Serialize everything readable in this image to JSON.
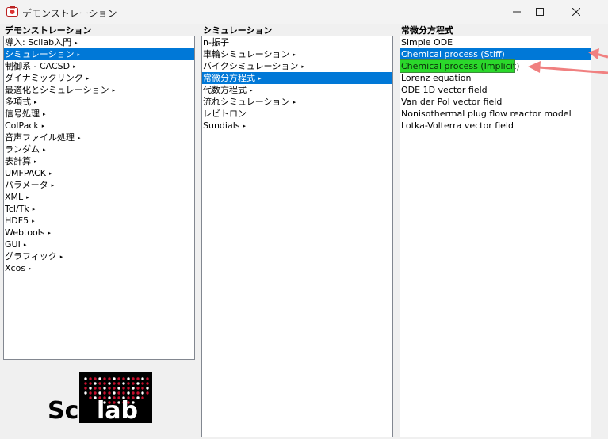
{
  "window": {
    "title": "デモンストレーション",
    "icon": "scilab-app-icon"
  },
  "columns": [
    {
      "header": "デモンストレーション",
      "items": [
        {
          "label": "導入: Scilab入門",
          "has_submenu": true
        },
        {
          "label": "シミュレーション",
          "has_submenu": true,
          "selected": true
        },
        {
          "label": "制御系 - CACSD",
          "has_submenu": true
        },
        {
          "label": "ダイナミックリンク",
          "has_submenu": true
        },
        {
          "label": "最適化とシミュレーション",
          "has_submenu": true
        },
        {
          "label": "多項式",
          "has_submenu": true
        },
        {
          "label": "信号処理",
          "has_submenu": true
        },
        {
          "label": "ColPack",
          "has_submenu": true
        },
        {
          "label": "音声ファイル処理",
          "has_submenu": true
        },
        {
          "label": "ランダム",
          "has_submenu": true
        },
        {
          "label": "表計算",
          "has_submenu": true
        },
        {
          "label": "UMFPACK",
          "has_submenu": true
        },
        {
          "label": "パラメータ",
          "has_submenu": true
        },
        {
          "label": "XML",
          "has_submenu": true
        },
        {
          "label": "Tcl/Tk",
          "has_submenu": true
        },
        {
          "label": "HDF5",
          "has_submenu": true
        },
        {
          "label": "Webtools",
          "has_submenu": true
        },
        {
          "label": "GUI",
          "has_submenu": true
        },
        {
          "label": "グラフィック",
          "has_submenu": true
        },
        {
          "label": "Xcos",
          "has_submenu": true
        }
      ]
    },
    {
      "header": "シミュレーション",
      "items": [
        {
          "label": "n-振子",
          "has_submenu": false
        },
        {
          "label": "車輪シミュレーション",
          "has_submenu": true
        },
        {
          "label": "バイクシミュレーション",
          "has_submenu": true
        },
        {
          "label": "常微分方程式",
          "has_submenu": true,
          "selected": true
        },
        {
          "label": "代数方程式",
          "has_submenu": true
        },
        {
          "label": "流れシミュレーション",
          "has_submenu": true
        },
        {
          "label": "レビトロン",
          "has_submenu": false
        },
        {
          "label": "Sundials",
          "has_submenu": true
        }
      ]
    },
    {
      "header": "常微分方程式",
      "items": [
        {
          "label": "Simple ODE",
          "has_submenu": false
        },
        {
          "label": "Chemical process (Stiff)",
          "has_submenu": false,
          "selected": true
        },
        {
          "label": "Chemical process (Implicit)",
          "has_submenu": false,
          "highlight": true
        },
        {
          "label": "Lorenz equation",
          "has_submenu": false
        },
        {
          "label": "ODE 1D vector field",
          "has_submenu": false
        },
        {
          "label": "Van der Pol vector field",
          "has_submenu": false
        },
        {
          "label": "Nonisothermal plug flow reactor model",
          "has_submenu": false
        },
        {
          "label": "Lotka-Volterra vector field",
          "has_submenu": false
        }
      ]
    }
  ],
  "logo": {
    "text_left": "Sci",
    "text_right": "lab",
    "colors": {
      "dots": "#c8102e",
      "text": "#ffffff",
      "background": "#000000"
    }
  },
  "annotations": {
    "arrow_color": "#f08080"
  },
  "colors": {
    "selection": "#0078d7",
    "highlight": "#2bd82b",
    "border": "#828790"
  }
}
